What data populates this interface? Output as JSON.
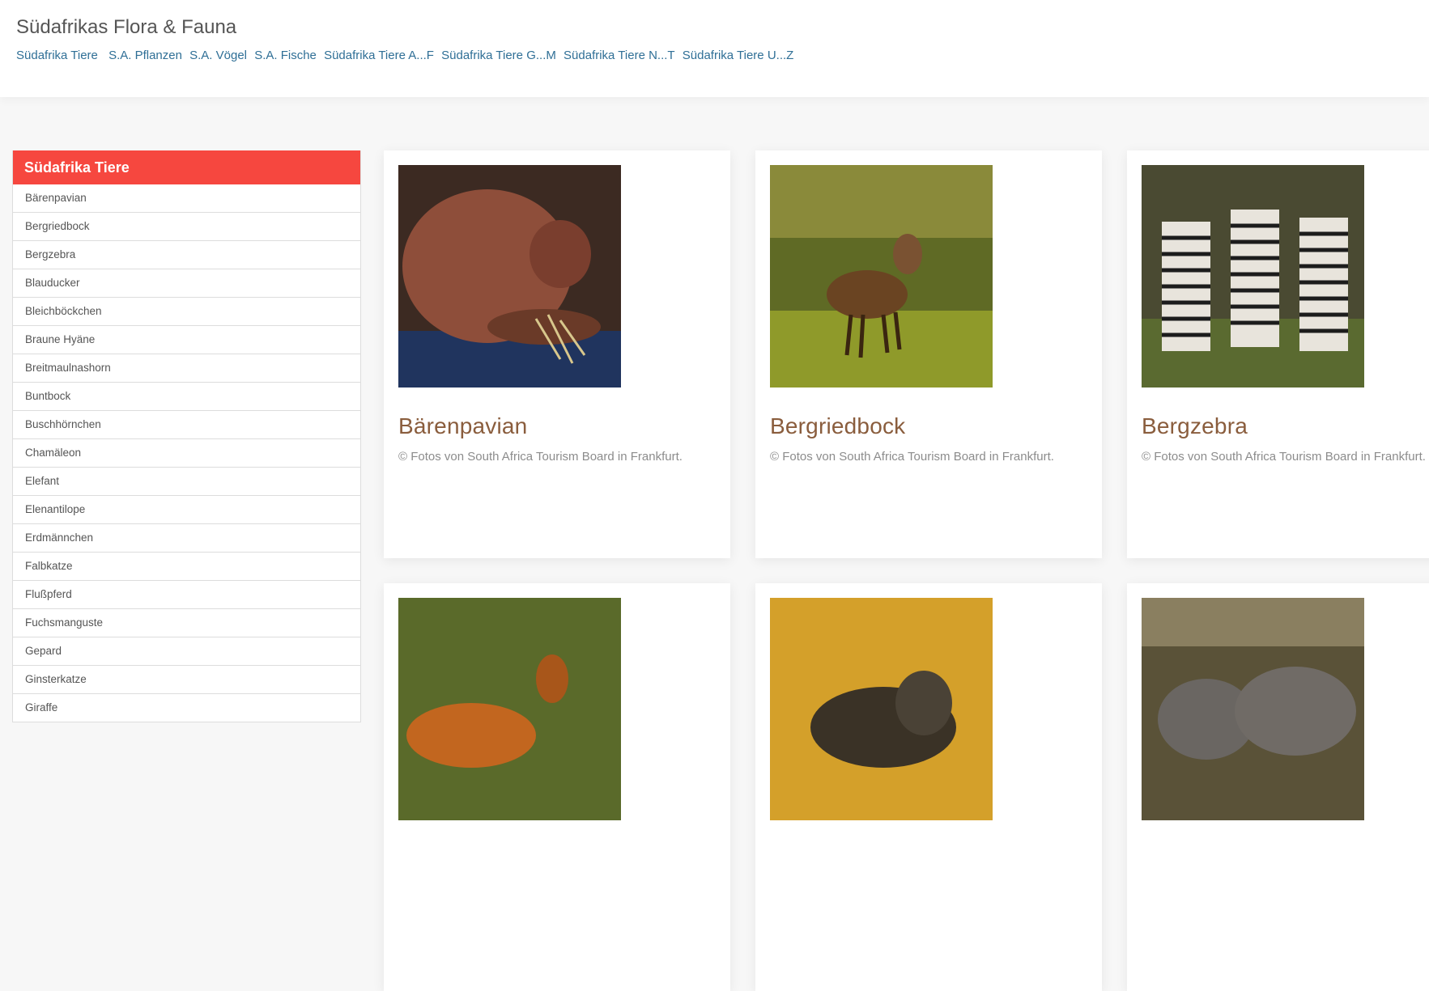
{
  "site": {
    "title": "Südafrikas Flora & Fauna",
    "nav": [
      "Südafrika Tiere",
      "S.A. Pflanzen",
      "S.A. Vögel",
      "S.A. Fische",
      "Südafrika Tiere A...F",
      "Südafrika Tiere G...M",
      "Südafrika Tiere N...T",
      "Südafrika Tiere U...Z"
    ]
  },
  "sidebar": {
    "title": "Südafrika Tiere",
    "items": [
      "Bärenpavian",
      "Bergriedbock",
      "Bergzebra",
      "Blauducker",
      "Bleichböckchen",
      "Braune Hyäne",
      "Breitmaulnashorn",
      "Buntbock",
      "Buschhörnchen",
      "Chamäleon",
      "Elefant",
      "Elenantilope",
      "Erdmännchen",
      "Falbkatze",
      "Flußpferd",
      "Fuchsmanguste",
      "Gepard",
      "Ginsterkatze",
      "Giraffe"
    ]
  },
  "cards": [
    {
      "title": "Bärenpavian",
      "caption": "© Fotos von South Africa Tourism Board in Frankfurt."
    },
    {
      "title": "Bergriedbock",
      "caption": "© Fotos von South Africa Tourism Board in Frankfurt."
    },
    {
      "title": "Bergzebra",
      "caption": "© Fotos von South Africa Tourism Board in Frankfurt."
    }
  ],
  "colors": {
    "sidebar_header": "#f6473f",
    "nav_link": "#2f6f96",
    "card_title": "#8a5d3d"
  }
}
